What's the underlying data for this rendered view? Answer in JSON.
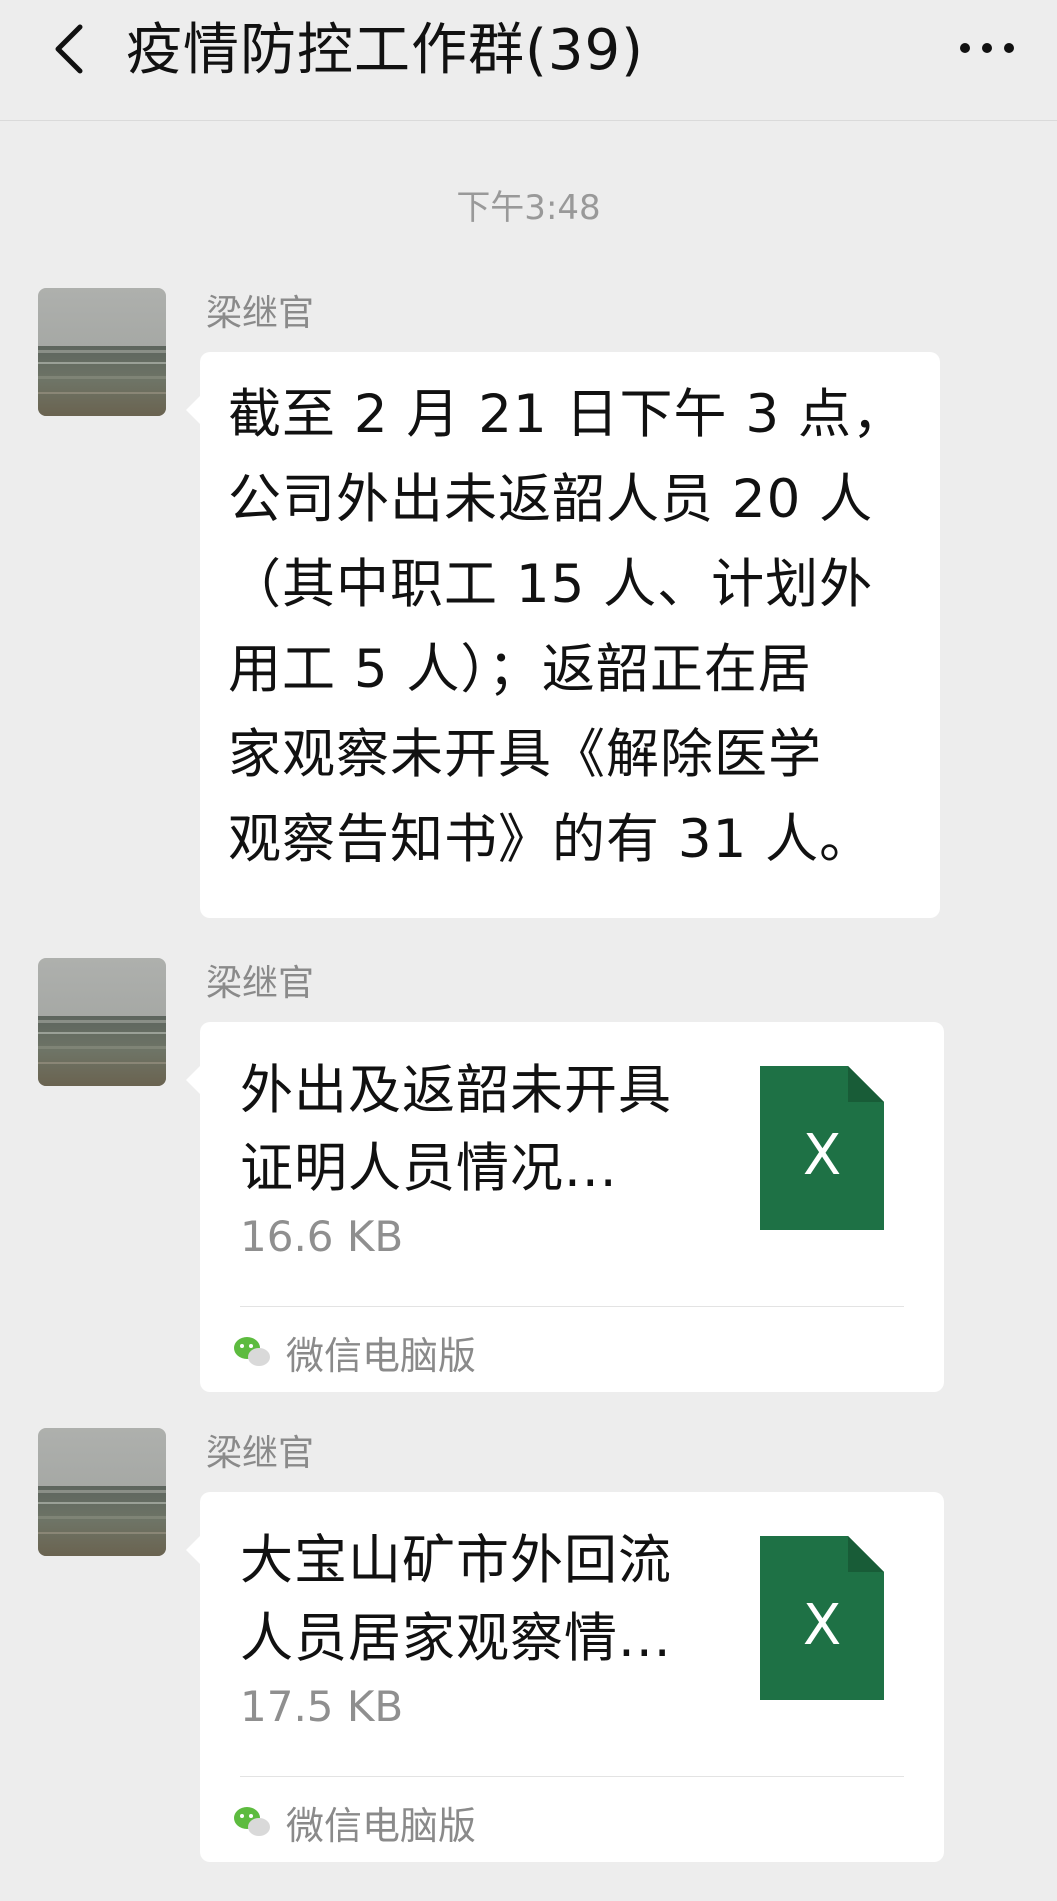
{
  "header": {
    "back_icon": "chevron-left-icon",
    "title": "疫情防控工作群(39)",
    "more_icon": "more-horizontal-icon"
  },
  "time_stamp": "下午3:48",
  "messages": [
    {
      "type": "text",
      "sender": "梁继官",
      "avatar_icon": "sea-landscape-avatar",
      "text": "截至 2 月 21 日下午 3 点，\n公司外出未返韶人员 20 人\n（其中职工 15 人、计划外\n用工 5 人）；返韶正在居\n家观察未开具《解除医学\n观察告知书》的有 31 人。"
    },
    {
      "type": "file",
      "sender": "梁继官",
      "avatar_icon": "sea-landscape-avatar",
      "file_name": "外出及返韶未开具\n证明人员情况...",
      "file_size": "16.6 KB",
      "file_icon": "excel-file-icon",
      "file_icon_letter": "X",
      "source_icon": "wechat-icon",
      "source": "微信电脑版"
    },
    {
      "type": "file",
      "sender": "梁继官",
      "avatar_icon": "sea-landscape-avatar",
      "file_name": "大宝山矿市外回流\n人员居家观察情...",
      "file_size": "17.5 KB",
      "file_icon": "excel-file-icon",
      "file_icon_letter": "X",
      "source_icon": "wechat-icon",
      "source": "微信电脑版"
    }
  ],
  "colors": {
    "background": "#ededed",
    "bubble": "#ffffff",
    "excel_green": "#1e7145",
    "excel_fold": "#185c37",
    "secondary_text": "#8a8a8a",
    "wechat_green": "#5dbb3f"
  }
}
